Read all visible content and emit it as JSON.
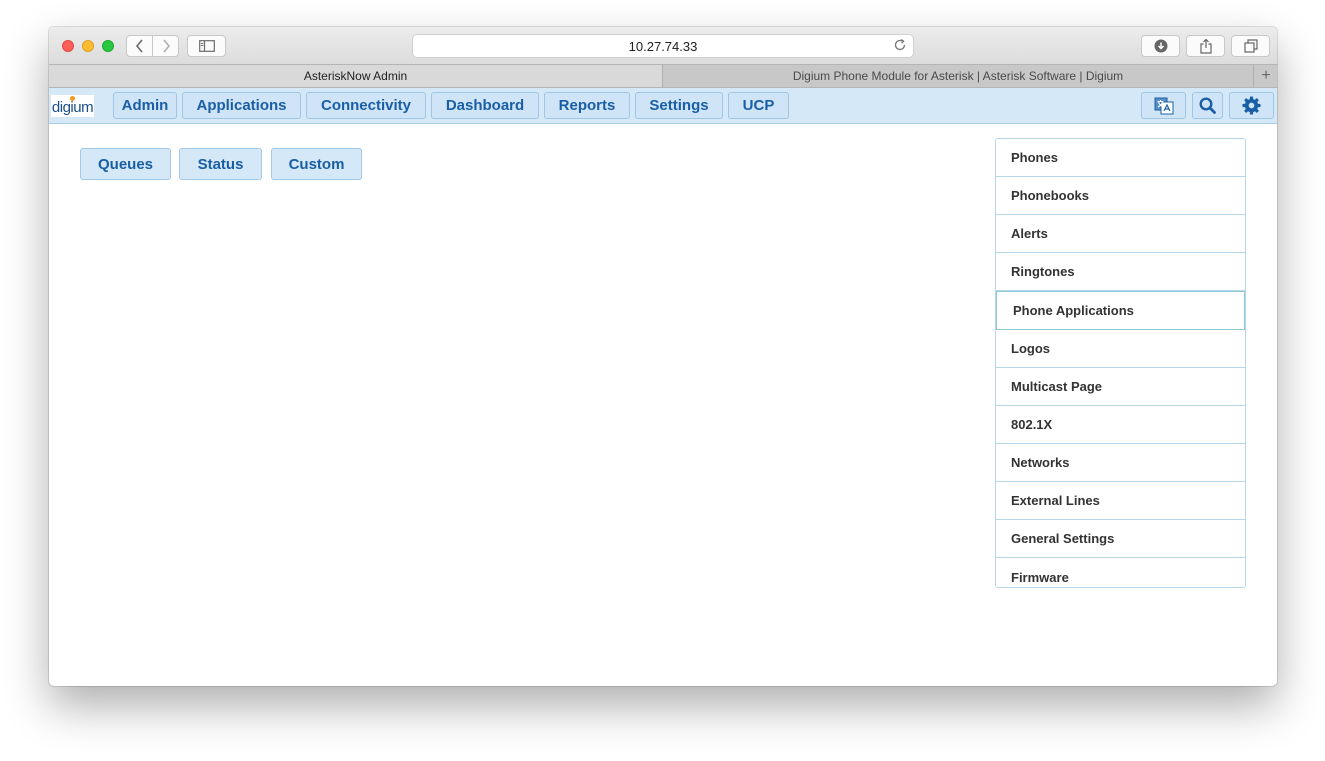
{
  "browser": {
    "url": "10.27.74.33",
    "tabs": [
      "AsteriskNow Admin",
      "Digium Phone Module for Asterisk | Asterisk Software | Digium"
    ],
    "new_tab": "+"
  },
  "app": {
    "logo": "digium",
    "nav": [
      "Admin",
      "Applications",
      "Connectivity",
      "Dashboard",
      "Reports",
      "Settings",
      "UCP"
    ],
    "accent": "#1a5fa5",
    "nav_bg": "#d4e8f7"
  },
  "subnav": [
    "Queues",
    "Status",
    "Custom"
  ],
  "sidebar": {
    "items": [
      "Phones",
      "Phonebooks",
      "Alerts",
      "Ringtones",
      "Phone Applications",
      "Logos",
      "Multicast Page",
      "802.1X",
      "Networks",
      "External Lines",
      "General Settings",
      "Firmware"
    ],
    "highlighted": "Phone Applications"
  },
  "icons": {
    "toolbar": [
      "back-icon",
      "forward-icon",
      "sidebar-icon",
      "reload-icon",
      "download-icon",
      "share-icon",
      "tabs-icon"
    ],
    "app": [
      "translate-icon",
      "search-icon",
      "gear-icon"
    ]
  }
}
